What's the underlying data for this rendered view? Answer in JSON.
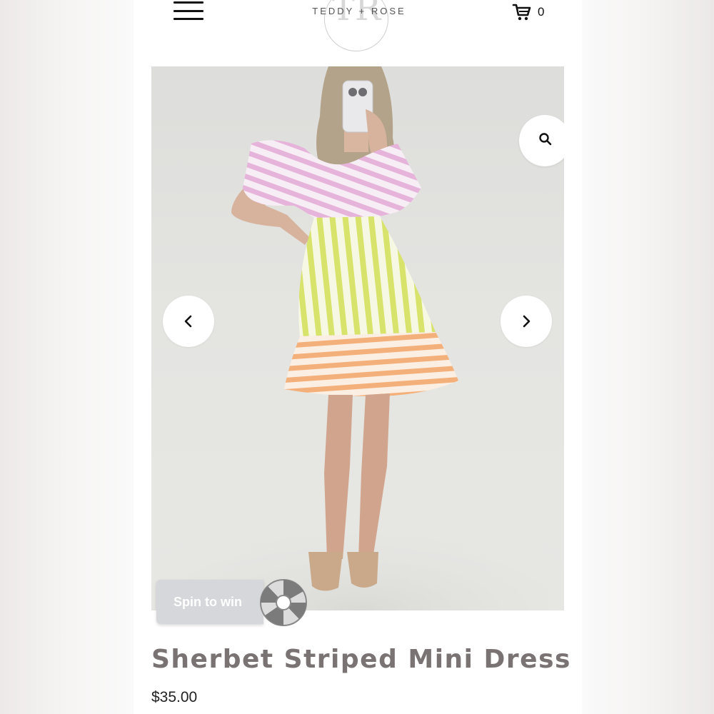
{
  "header": {
    "logo_monogram": "TR",
    "logo_text": "TEDDY + ROSE",
    "cart_count": "0",
    "icons": [
      "hamburger-menu-icon",
      "cart-icon"
    ]
  },
  "gallery": {
    "icons": [
      "search-icon",
      "chevron-left-icon",
      "chevron-right-icon"
    ]
  },
  "promo": {
    "spin_label": "Spin to win",
    "icon": "prize-wheel-icon"
  },
  "product": {
    "title": "Sherbet Striped Mini Dress",
    "price": "$35.00"
  },
  "colors": {
    "title": "#7a7373",
    "stripe_pink": "#e6b3da",
    "stripe_lime": "#d7e36a",
    "stripe_orange": "#f4b07a"
  }
}
